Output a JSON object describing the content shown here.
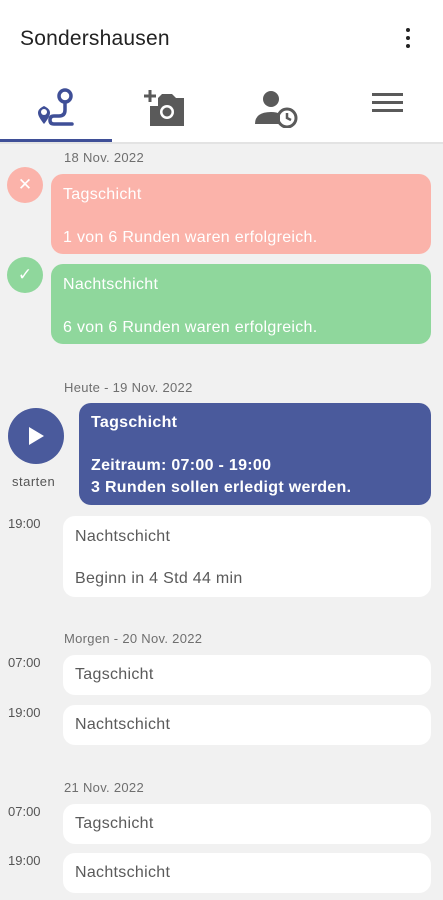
{
  "app": {
    "title": "Sondershausen"
  },
  "tabs": [
    {
      "icon": "route-icon",
      "active": true
    },
    {
      "icon": "add-photo-icon",
      "active": false
    },
    {
      "icon": "person-clock-icon",
      "active": false
    },
    {
      "icon": "hamburger-menu-icon",
      "active": false
    }
  ],
  "colors": {
    "accent": "#3f4f97",
    "failed": "#fbb3aa",
    "success": "#8fd79c",
    "active": "#4a5a9c"
  },
  "sections": {
    "past": {
      "date": "18 Nov. 2022",
      "shifts": [
        {
          "name": "Tagschicht",
          "detail": "1 von 6 Runden waren erfolgreich.",
          "status_icon": "close-icon"
        },
        {
          "name": "Nachtschicht",
          "detail": "6 von 6 Runden waren erfolgreich.",
          "status_icon": "check-icon"
        }
      ]
    },
    "today": {
      "date": "Heute - 19 Nov. 2022",
      "start_label": "starten",
      "current": {
        "name": "Tagschicht",
        "period": "Zeitraum: 07:00 - 19:00",
        "rounds": "3 Runden sollen erledigt werden."
      },
      "next": {
        "time": "19:00",
        "name": "Nachtschicht",
        "detail": "Beginn in 4 Std 44 min"
      }
    },
    "tomorrow": {
      "date": "Morgen - 20 Nov. 2022",
      "shifts": [
        {
          "time": "07:00",
          "name": "Tagschicht"
        },
        {
          "time": "19:00",
          "name": "Nachtschicht"
        }
      ]
    },
    "day_after": {
      "date": "21 Nov. 2022",
      "shifts": [
        {
          "time": "07:00",
          "name": "Tagschicht"
        },
        {
          "time": "19:00",
          "name": "Nachtschicht"
        }
      ]
    }
  }
}
